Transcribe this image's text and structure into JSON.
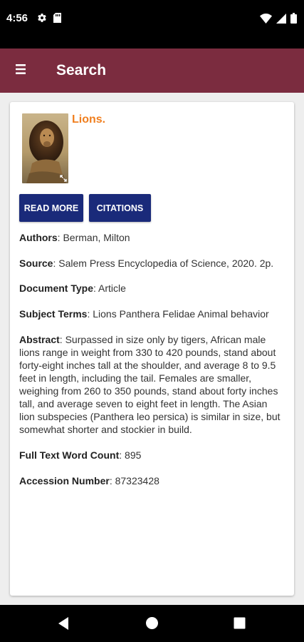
{
  "status_bar": {
    "time": "4:56",
    "left_icons": [
      "gear-icon",
      "sim-card-icon"
    ],
    "right_icons": [
      "wifi-icon",
      "cell-signal-icon",
      "battery-icon"
    ]
  },
  "app_bar": {
    "title": "Search",
    "color": "#7b2c3f"
  },
  "article": {
    "title": "Lions.",
    "title_color": "#f07f1f",
    "buttons": {
      "read_more": "READ MORE",
      "citations": "CITATIONS"
    },
    "button_color": "#1a2a7a",
    "fields": {
      "authors": {
        "label": "Authors",
        "value": "Berman, Milton"
      },
      "source": {
        "label": "Source",
        "value": "Salem Press Encyclopedia of Science, 2020. 2p."
      },
      "document_type": {
        "label": "Document Type",
        "value": "Article"
      },
      "subject_terms": {
        "label": "Subject Terms",
        "value": "Lions Panthera Felidae Animal behavior"
      },
      "abstract": {
        "label": "Abstract",
        "value": "Surpassed in size only by tigers, African male lions range in weight from 330 to 420 pounds, stand about forty-eight inches tall at the shoulder, and average 8 to 9.5 feet in length, including the tail. Females are smaller, weighing from 260 to 350 pounds, stand about forty inches tall, and average seven to eight feet in length. The Asian lion subspecies (Panthera leo persica) is similar in size, but somewhat shorter and stockier in build."
      },
      "word_count": {
        "label": "Full Text Word Count",
        "value": "895"
      },
      "accession_number": {
        "label": "Accession Number",
        "value": "87323428"
      }
    }
  },
  "nav_bar": {
    "icons": [
      "back-icon",
      "home-icon",
      "recents-icon"
    ]
  }
}
